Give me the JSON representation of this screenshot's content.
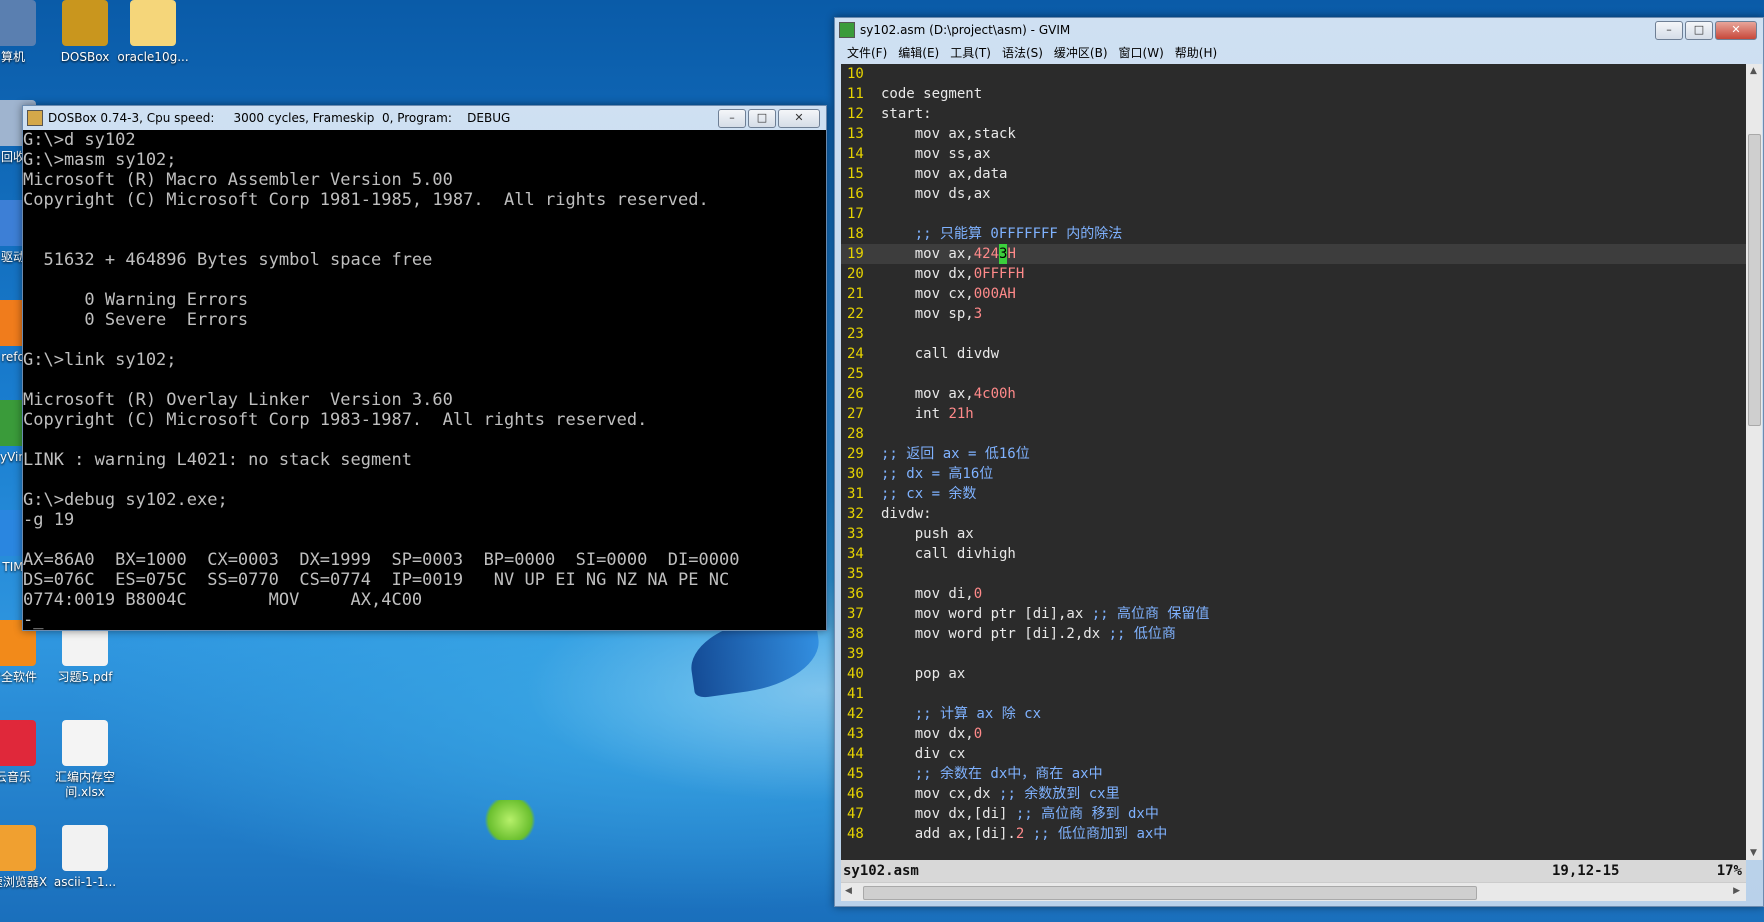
{
  "desktop": {
    "icons": [
      {
        "label": "算机"
      },
      {
        "label": "DOSBox"
      },
      {
        "label": "oracle10g..."
      },
      {
        "label": "回收"
      },
      {
        "label": "驱动"
      },
      {
        "label": "refo"
      },
      {
        "label": "yVin"
      },
      {
        "label": "TIM"
      },
      {
        "label": "安全软件"
      },
      {
        "label": "习题5.pdf"
      },
      {
        "label": "云音乐"
      },
      {
        "label": "汇编内存空间.xlsx"
      },
      {
        "label": "极速浏览器X"
      },
      {
        "label": "ascii-1-1..."
      }
    ]
  },
  "dosbox": {
    "title": "DOSBox 0.74-3, Cpu speed:     3000 cycles, Frameskip  0, Program:    DEBUG",
    "lines": [
      "G:\\>d sy102",
      "G:\\>masm sy102;",
      "Microsoft (R) Macro Assembler Version 5.00",
      "Copyright (C) Microsoft Corp 1981-1985, 1987.  All rights reserved.",
      "",
      "",
      "  51632 + 464896 Bytes symbol space free",
      "",
      "      0 Warning Errors",
      "      0 Severe  Errors",
      "",
      "G:\\>link sy102;",
      "",
      "Microsoft (R) Overlay Linker  Version 3.60",
      "Copyright (C) Microsoft Corp 1983-1987.  All rights reserved.",
      "",
      "LINK : warning L4021: no stack segment",
      "",
      "G:\\>debug sy102.exe;",
      "-g 19",
      "",
      "AX=86A0  BX=1000  CX=0003  DX=1999  SP=0003  BP=0000  SI=0000  DI=0000",
      "DS=076C  ES=075C  SS=0770  CS=0774  IP=0019   NV UP EI NG NZ NA PE NC",
      "0774:0019 B8004C        MOV     AX,4C00",
      "-_"
    ]
  },
  "gvim": {
    "title": "sy102.asm (D:\\project\\asm) - GVIM",
    "menu": [
      "文件(F)",
      "编辑(E)",
      "工具(T)",
      "语法(S)",
      "缓冲区(B)",
      "窗口(W)",
      "帮助(H)"
    ],
    "lines": [
      {
        "n": "10",
        "code": "",
        "comment": ""
      },
      {
        "n": "11",
        "code": "code segment",
        "comment": ""
      },
      {
        "n": "12",
        "code": "start:",
        "comment": ""
      },
      {
        "n": "13",
        "code": "    mov ax,stack",
        "comment": ""
      },
      {
        "n": "14",
        "code": "    mov ss,ax",
        "comment": ""
      },
      {
        "n": "15",
        "code": "    mov ax,data",
        "comment": ""
      },
      {
        "n": "16",
        "code": "    mov ds,ax",
        "comment": ""
      },
      {
        "n": "17",
        "code": "",
        "comment": ""
      },
      {
        "n": "18",
        "code": "    ",
        "comment": ";; 只能算 0FFFFFFF 内的除法"
      },
      {
        "n": "19",
        "code": "    mov ax,",
        "num": "424",
        "cur": "3",
        "tail": "H",
        "current": true
      },
      {
        "n": "20",
        "code": "    mov dx,",
        "num": "0FFFFH"
      },
      {
        "n": "21",
        "code": "    mov cx,",
        "num": "000AH"
      },
      {
        "n": "22",
        "code": "    mov sp,",
        "num": "3"
      },
      {
        "n": "23",
        "code": "",
        "comment": ""
      },
      {
        "n": "24",
        "code": "    call divdw",
        "comment": ""
      },
      {
        "n": "25",
        "code": "",
        "comment": ""
      },
      {
        "n": "26",
        "code": "    mov ax,",
        "num": "4c00h"
      },
      {
        "n": "27",
        "code": "    int ",
        "num": "21h"
      },
      {
        "n": "28",
        "code": "",
        "comment": ""
      },
      {
        "n": "29",
        "code": "",
        "comment": ";; 返回 ax = 低16位"
      },
      {
        "n": "30",
        "code": "",
        "comment": ";; dx = 高16位"
      },
      {
        "n": "31",
        "code": "",
        "comment": ";; cx = 余数"
      },
      {
        "n": "32",
        "code": "divdw:",
        "comment": ""
      },
      {
        "n": "33",
        "code": "    push ax",
        "comment": ""
      },
      {
        "n": "34",
        "code": "    call divhigh",
        "comment": ""
      },
      {
        "n": "35",
        "code": "",
        "comment": ""
      },
      {
        "n": "36",
        "code": "    mov di,",
        "num": "0"
      },
      {
        "n": "37",
        "code": "    mov word ptr [di],ax ",
        "comment": ";; 高位商 保留值"
      },
      {
        "n": "38",
        "code": "    mov word ptr [di].2,dx ",
        "comment": ";; 低位商"
      },
      {
        "n": "39",
        "code": "",
        "comment": ""
      },
      {
        "n": "40",
        "code": "    pop ax",
        "comment": ""
      },
      {
        "n": "41",
        "code": "",
        "comment": ""
      },
      {
        "n": "42",
        "code": "    ",
        "comment": ";; 计算 ax 除 cx"
      },
      {
        "n": "43",
        "code": "    mov dx,",
        "num": "0"
      },
      {
        "n": "44",
        "code": "    div cx",
        "comment": ""
      },
      {
        "n": "45",
        "code": "    ",
        "comment": ";; 余数在 dx中，商在 ax中"
      },
      {
        "n": "46",
        "code": "    mov cx,dx ",
        "comment": ";; 余数放到 cx里"
      },
      {
        "n": "47",
        "code": "    mov dx,[di] ",
        "comment": ";; 高位商 移到 dx中"
      },
      {
        "n": "48",
        "code": "    add ax,[di].",
        "num": "2",
        "tail": " ",
        "comment": ";; 低位商加到 ax中"
      }
    ],
    "status": {
      "file": "sy102.asm",
      "pos": "19,12-15",
      "percent": "17%"
    }
  }
}
